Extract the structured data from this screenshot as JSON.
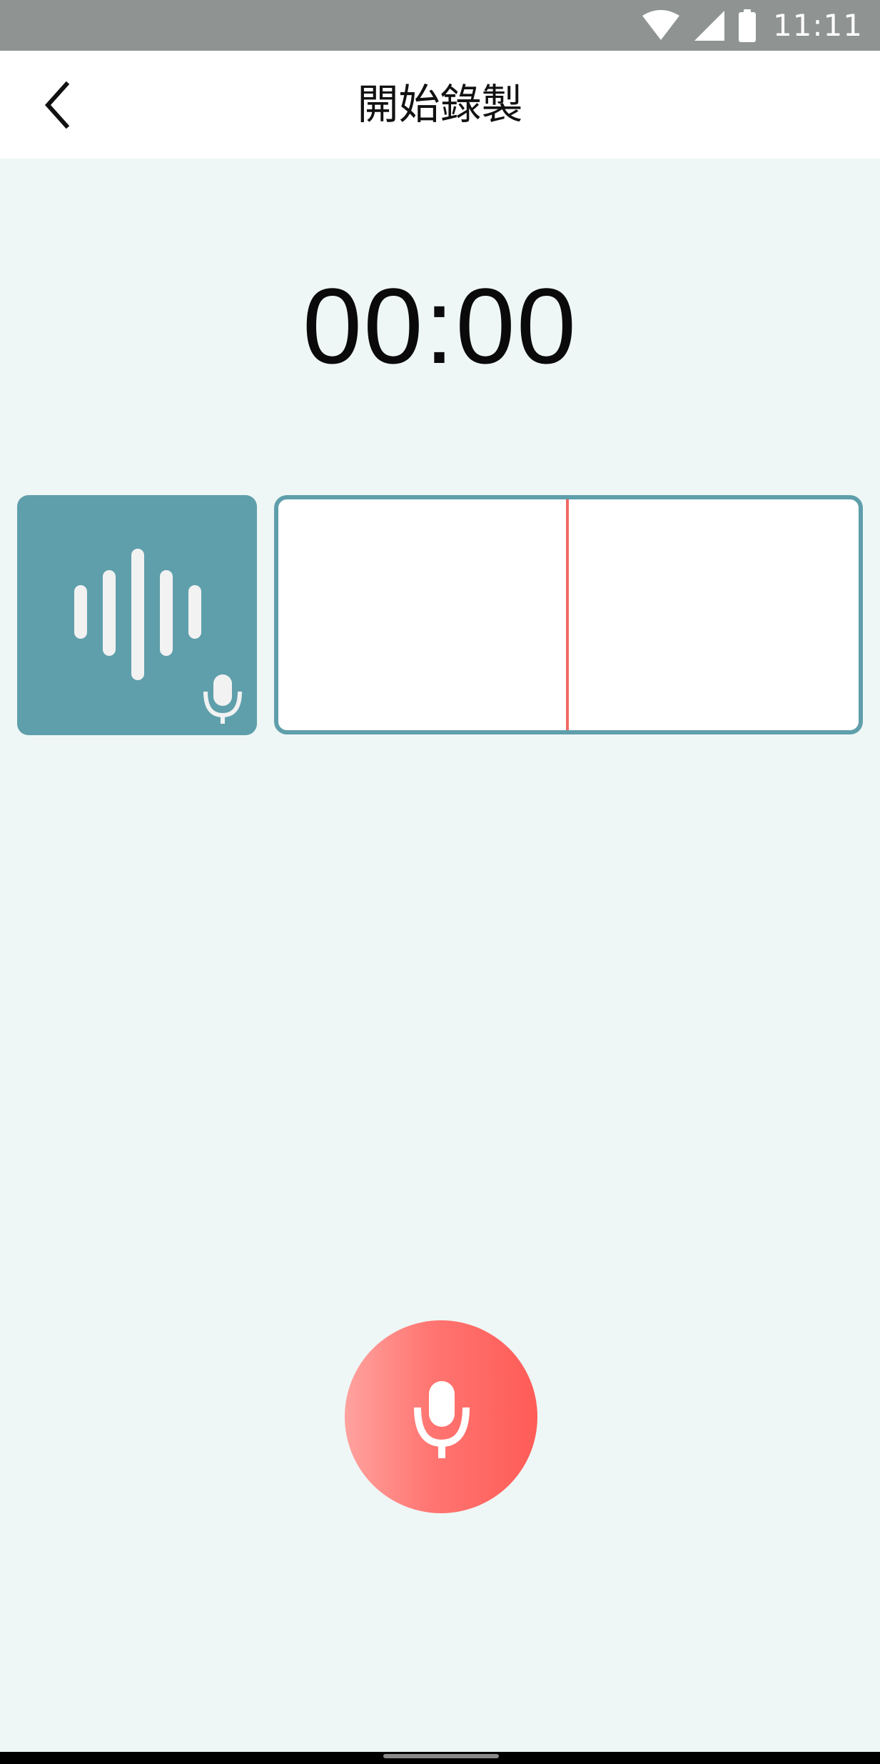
{
  "status_bar": {
    "time": "11:11",
    "icons": [
      "wifi-icon",
      "signal-icon",
      "battery-icon"
    ]
  },
  "app_bar": {
    "title": "開始錄製",
    "back_icon": "chevron-left-icon"
  },
  "timer": {
    "value": "00:00"
  },
  "waveform_tile": {
    "icon": "audio-wave-icon",
    "badge_icon": "microphone-icon"
  },
  "record_button": {
    "icon": "microphone-icon"
  },
  "colors": {
    "background": "#eef7f6",
    "accent": "#5f9fab",
    "record": "#ff5c57",
    "playhead": "#f06a63",
    "status_bar": "#8f9392"
  }
}
